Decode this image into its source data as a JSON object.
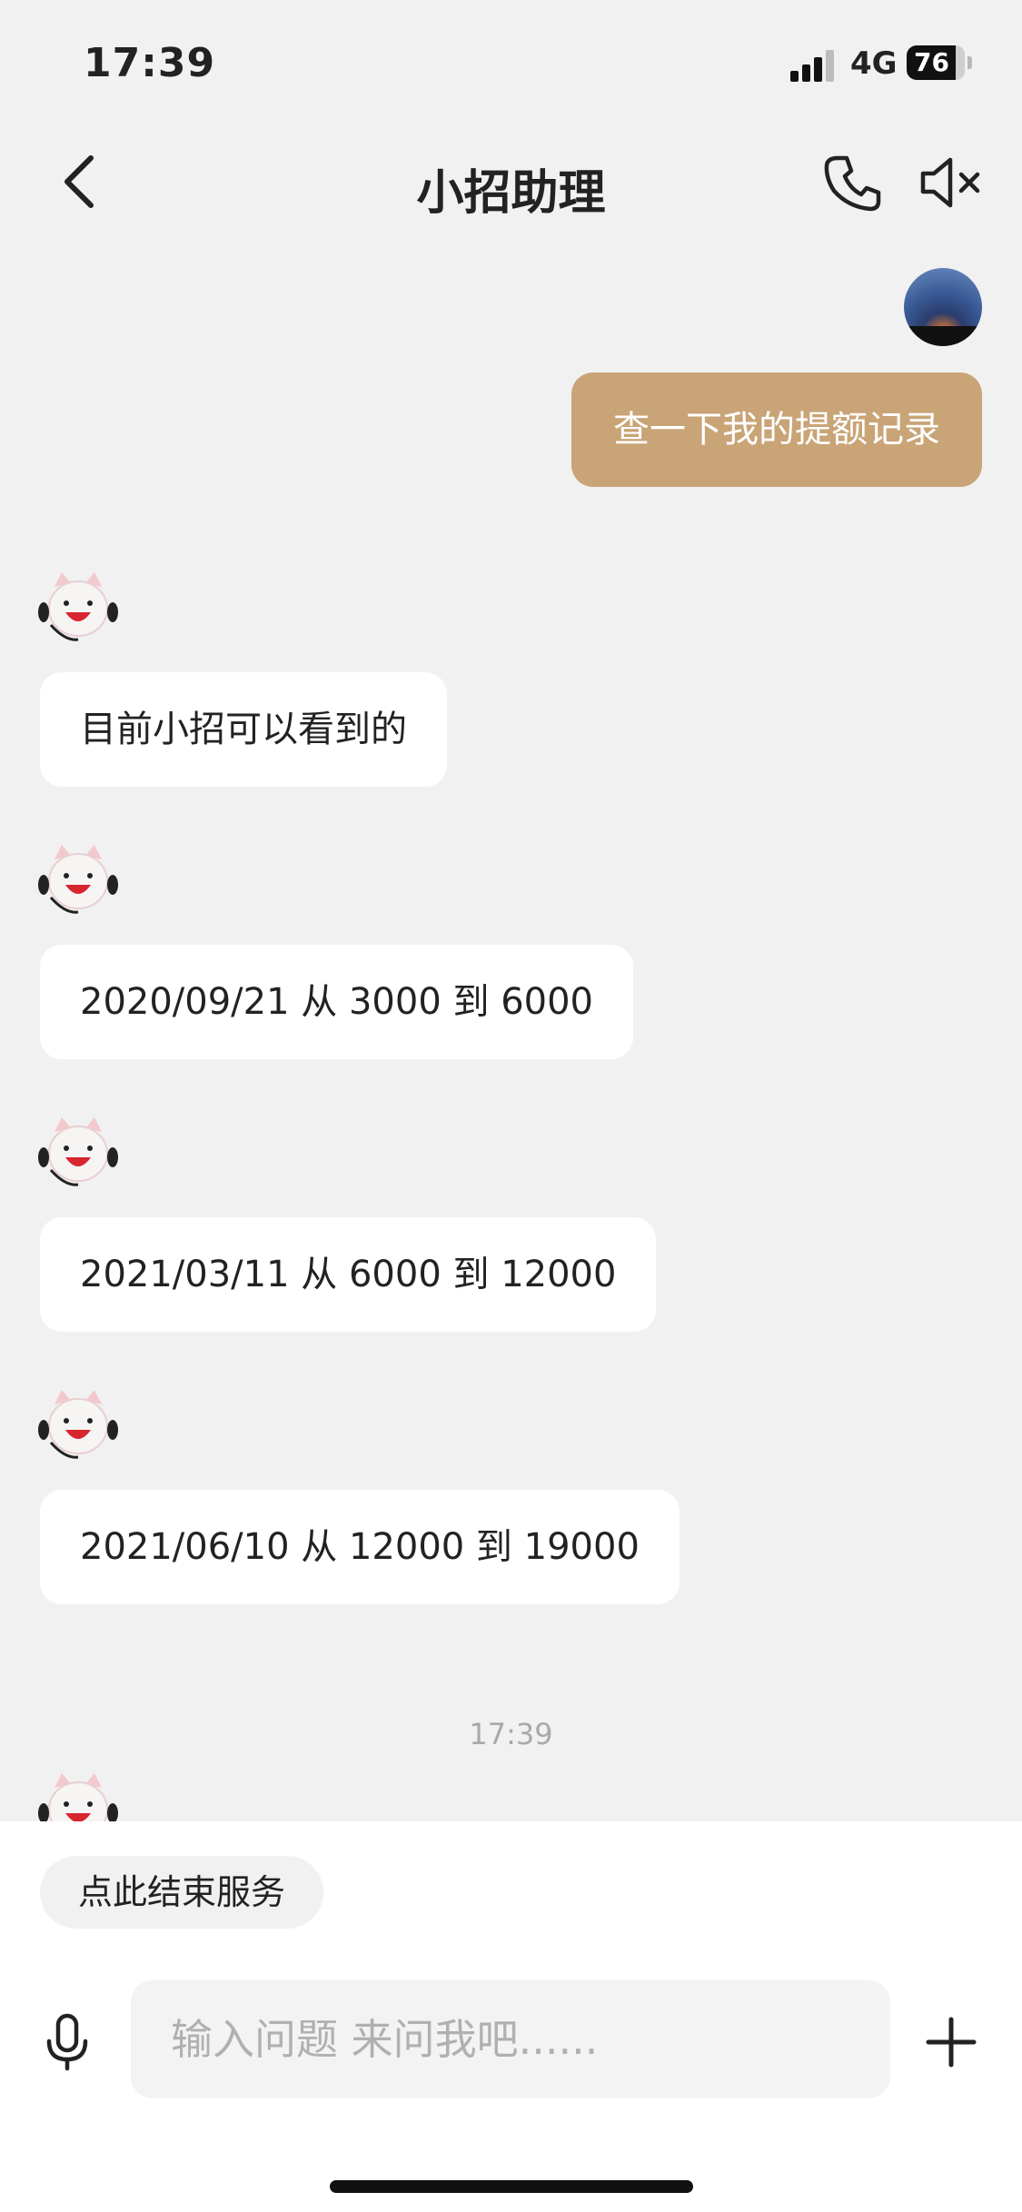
{
  "status_bar": {
    "time": "17:39",
    "network": "4G",
    "battery": "76"
  },
  "nav": {
    "title": "小招助理",
    "back_icon": "chevron-left-icon",
    "phone_icon": "phone-icon",
    "mute_icon": "speaker-muted-icon"
  },
  "messages": {
    "user_query": "查一下我的提额记录",
    "bot_intro": "目前小招可以看到的",
    "records": [
      "2020/09/21 从 3000 到 6000",
      "2021/03/11 从 6000 到 12000",
      "2021/06/10 从 12000 到 19000"
    ]
  },
  "timestamp": "17:39",
  "bottom": {
    "end_service": "点此结束服务",
    "input_placeholder": "输入问题 来问我吧......",
    "mic_icon": "microphone-icon",
    "plus_icon": "plus-icon"
  },
  "colors": {
    "user_bubble": "#c9a476",
    "bot_bubble": "#ffffff",
    "background": "#f1f1f1"
  }
}
